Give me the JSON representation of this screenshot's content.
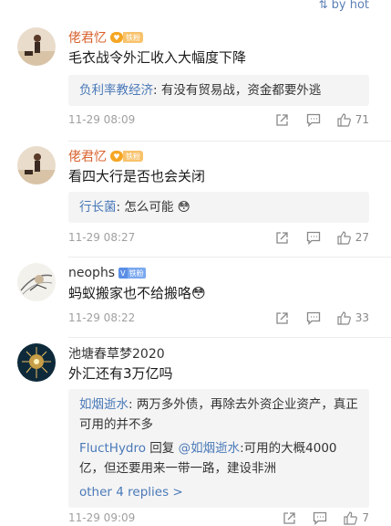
{
  "sort": {
    "label": "by hot",
    "icon": "sort-icon"
  },
  "comments": [
    {
      "username": "佬君忆",
      "badge": "铁粉",
      "text": "毛衣战令外汇收入大幅度下降",
      "replies": [
        {
          "name": "负利率教经济",
          "text": ": 有没有贸易战，资金都要外逃"
        }
      ],
      "time": "11-29 08:09",
      "likes": "71"
    },
    {
      "username": "佬君忆",
      "badge": "铁粉",
      "text": "看四大行是否也会关闭",
      "replies": [
        {
          "name": "行长菌",
          "text": ": 怎么可能 😳"
        }
      ],
      "time": "11-29 08:27",
      "likes": "27"
    },
    {
      "username": "neophs",
      "badge": "铁粉",
      "text": "蚂蚁搬家也不给搬咯😳",
      "time": "11-29 08:22",
      "likes": "33"
    },
    {
      "username": "池塘春草梦2020",
      "text": "外汇还有3万亿吗",
      "replies": [
        {
          "name": "如烟逝水",
          "text": ": 两万多外债，再除去外资企业资产，真正可用的并不多"
        },
        {
          "name": "FluctHydro",
          "mid": " 回复 ",
          "mention": "@如烟逝水",
          "text": ":可用的大概4000亿，但还要用来一带一路，建设非洲"
        }
      ],
      "more": "other 4 replies >",
      "time": "11-29 09:09",
      "likes": "7"
    }
  ],
  "colors": {
    "username": "#d8612c",
    "link": "#4a79b8",
    "meta": "#a0a0a0"
  }
}
